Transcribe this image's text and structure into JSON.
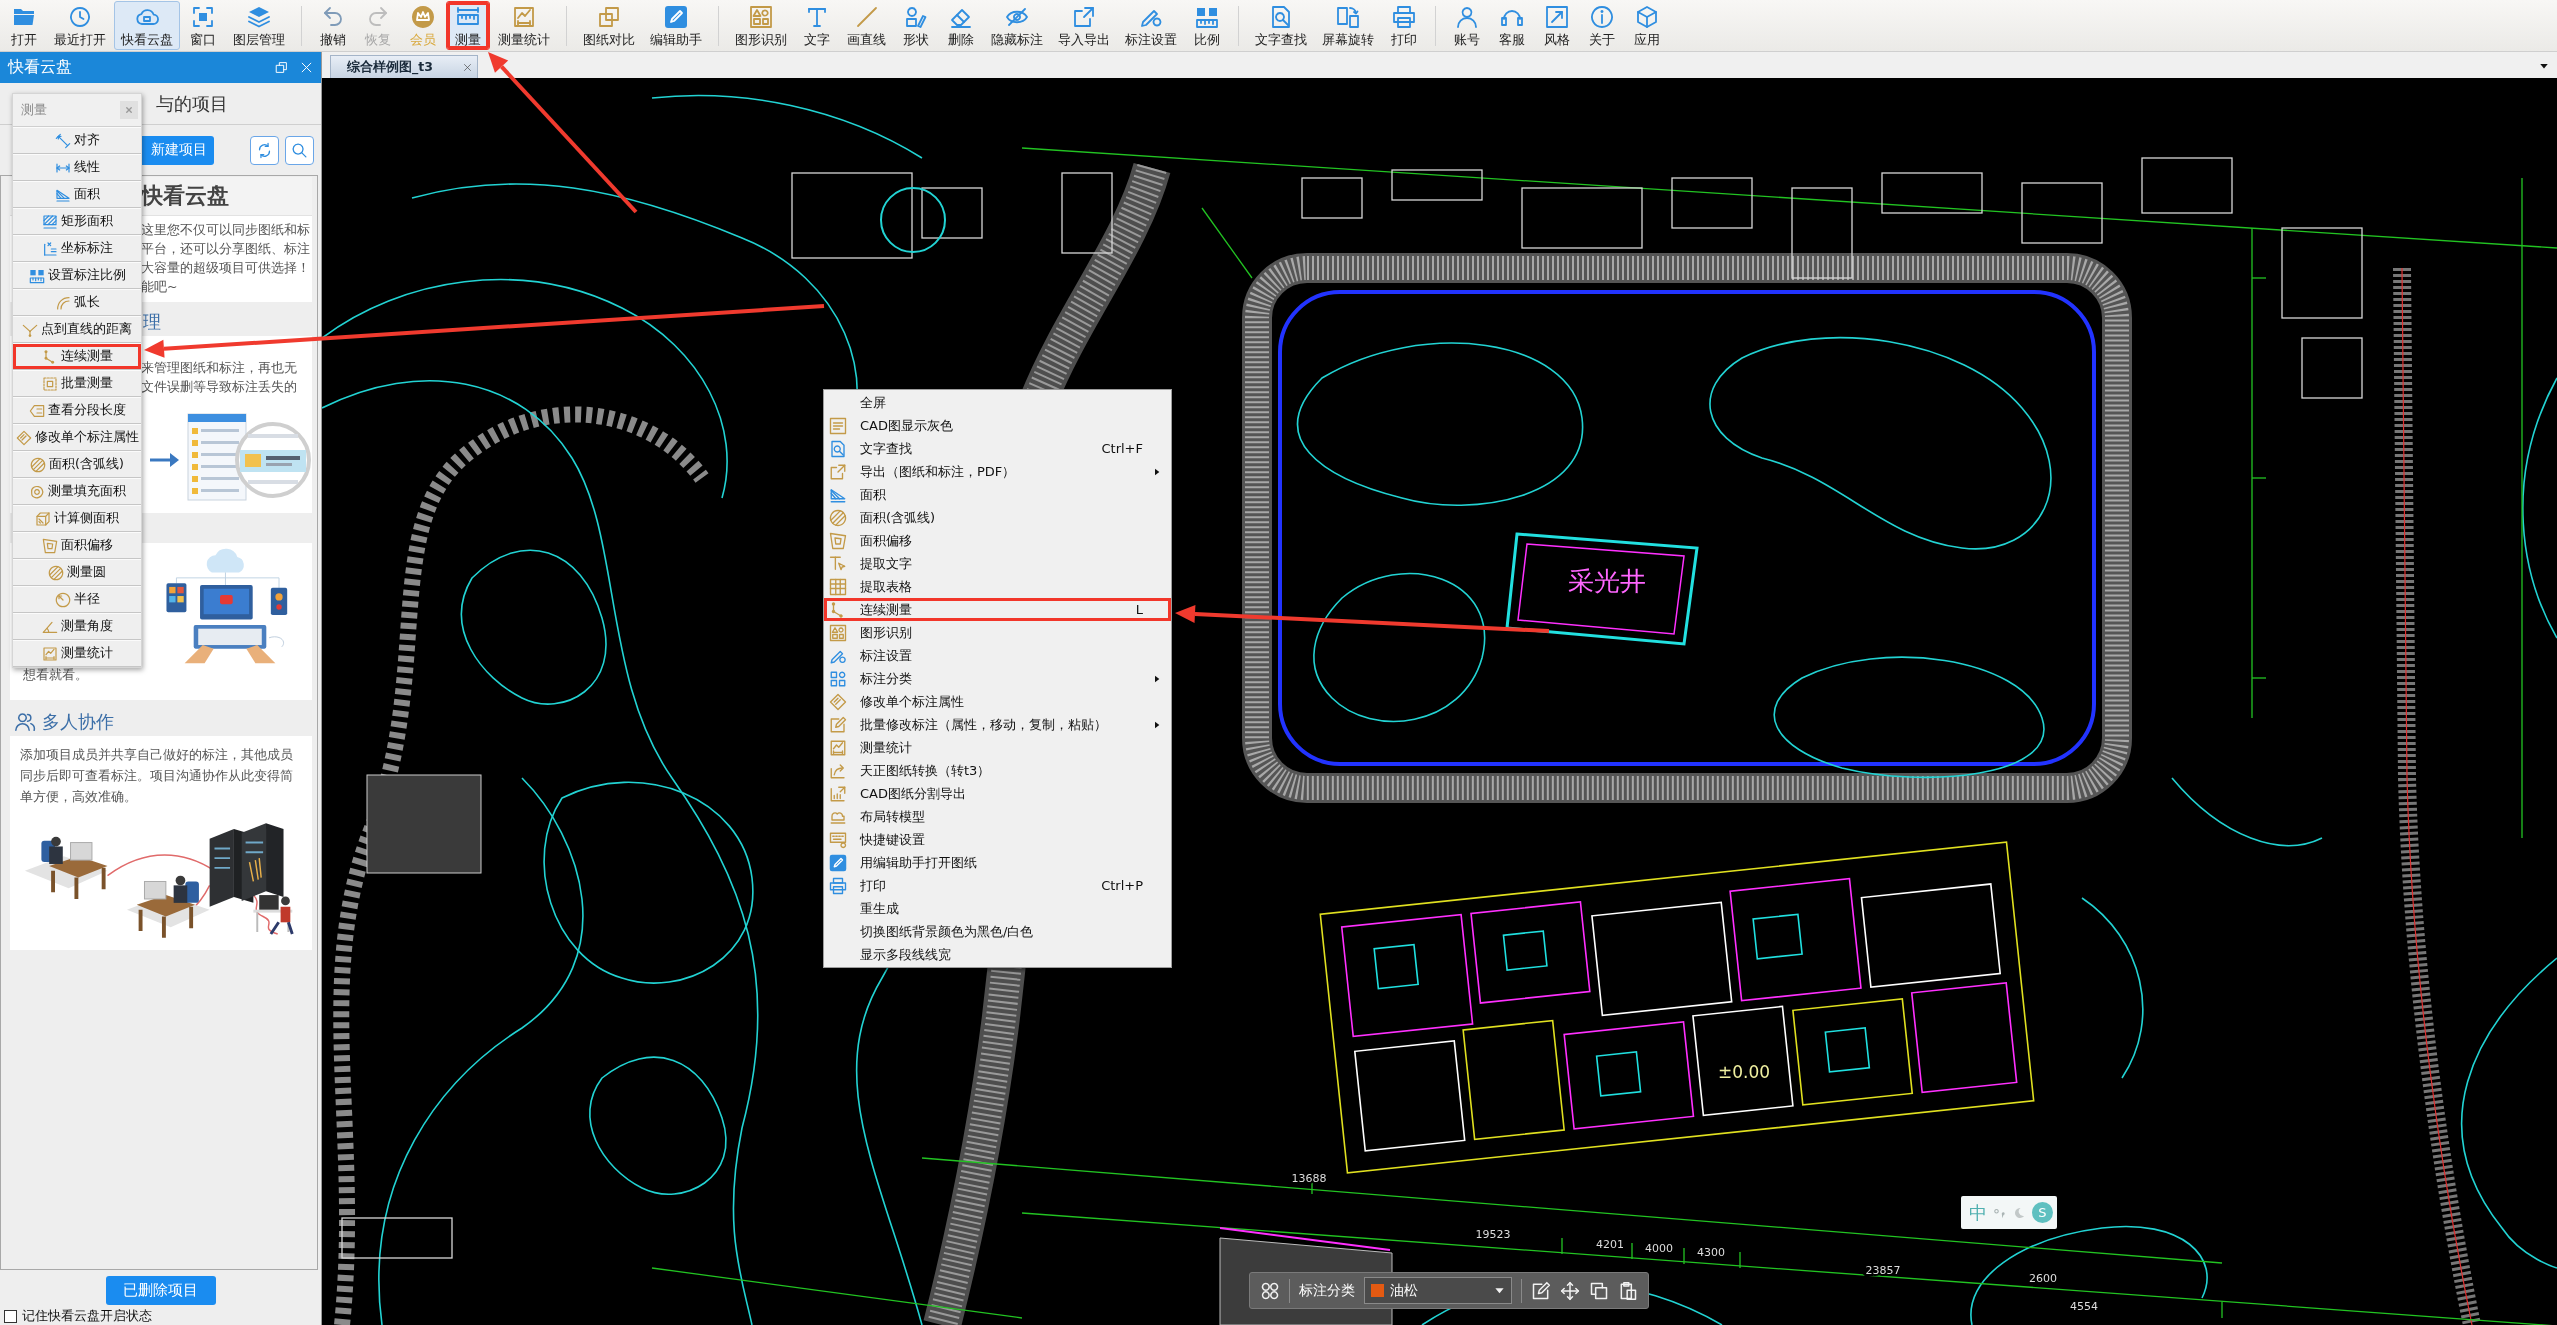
{
  "toolbar": {
    "groups": [
      [
        {
          "label": "打开",
          "kind": "tool",
          "active": false,
          "disabled": false,
          "callout": false
        },
        {
          "label": "最近打开",
          "kind": "tool",
          "active": false,
          "disabled": false,
          "callout": false
        },
        {
          "label": "快看云盘",
          "kind": "tool",
          "active": true,
          "disabled": false,
          "callout": false
        },
        {
          "label": "窗口",
          "kind": "tool",
          "active": false,
          "disabled": false,
          "callout": false
        },
        {
          "label": "图层管理",
          "kind": "tool",
          "active": false,
          "disabled": false,
          "callout": false
        }
      ],
      [
        {
          "label": "撤销",
          "kind": "tool",
          "active": false,
          "disabled": false,
          "callout": false
        },
        {
          "label": "恢复",
          "kind": "tool",
          "active": false,
          "disabled": true,
          "callout": false
        },
        {
          "label": "会员",
          "kind": "vip",
          "active": false,
          "disabled": false,
          "callout": false
        },
        {
          "label": "测量",
          "kind": "tool",
          "active": true,
          "disabled": false,
          "callout": true
        },
        {
          "label": "测量统计",
          "kind": "tool",
          "active": false,
          "disabled": false,
          "callout": false
        }
      ],
      [
        {
          "label": "图纸对比",
          "kind": "tool",
          "active": false,
          "disabled": false,
          "callout": false
        },
        {
          "label": "编辑助手",
          "kind": "tool",
          "active": false,
          "disabled": false,
          "callout": false
        }
      ],
      [
        {
          "label": "图形识别",
          "kind": "tool",
          "active": false,
          "disabled": false,
          "callout": false
        },
        {
          "label": "文字",
          "kind": "tool",
          "active": false,
          "disabled": false,
          "callout": false
        },
        {
          "label": "画直线",
          "kind": "tool",
          "active": false,
          "disabled": false,
          "callout": false
        },
        {
          "label": "形状",
          "kind": "tool",
          "active": false,
          "disabled": false,
          "callout": false
        },
        {
          "label": "删除",
          "kind": "tool",
          "active": false,
          "disabled": false,
          "callout": false
        },
        {
          "label": "隐藏标注",
          "kind": "tool",
          "active": false,
          "disabled": false,
          "callout": false
        },
        {
          "label": "导入导出",
          "kind": "tool",
          "active": false,
          "disabled": false,
          "callout": false
        },
        {
          "label": "标注设置",
          "kind": "tool",
          "active": false,
          "disabled": false,
          "callout": false
        },
        {
          "label": "比例",
          "kind": "tool",
          "active": false,
          "disabled": false,
          "callout": false
        }
      ],
      [
        {
          "label": "文字查找",
          "kind": "tool",
          "active": false,
          "disabled": false,
          "callout": false
        },
        {
          "label": "屏幕旋转",
          "kind": "tool",
          "active": false,
          "disabled": false,
          "callout": false
        },
        {
          "label": "打印",
          "kind": "tool",
          "active": false,
          "disabled": false,
          "callout": false
        }
      ],
      [
        {
          "label": "账号",
          "kind": "tool",
          "active": false,
          "disabled": false,
          "callout": false
        },
        {
          "label": "客服",
          "kind": "tool",
          "active": false,
          "disabled": false,
          "callout": false
        },
        {
          "label": "风格",
          "kind": "tool",
          "active": false,
          "disabled": false,
          "callout": false
        },
        {
          "label": "关于",
          "kind": "tool",
          "active": false,
          "disabled": false,
          "callout": false
        },
        {
          "label": "应用",
          "kind": "tool",
          "active": false,
          "disabled": false,
          "callout": false
        }
      ]
    ]
  },
  "tabs": [
    {
      "label": "综合样例图_t3",
      "selected": true
    }
  ],
  "cloud_panel": {
    "title": "快看云盘",
    "projects_heading": "与的项目",
    "new_project_button": "新建项目",
    "cards": [
      {
        "heading": "快看云盘",
        "lines": [
          "这里您不仅可以同步图纸和标",
          "平台，还可以分享图纸、标注",
          "大容量的超级项目可供选择！",
          "能吧~"
        ]
      },
      {
        "heading": "理",
        "lines": [
          "来管理图纸和标注，再也无",
          "文件误删等导致标注丢失的"
        ]
      },
      {
        "lines": [
          "想看就看。"
        ]
      },
      {
        "heading": "多人协作",
        "lines": [
          "添加项目成员并共享自己做好的标注，其他成员同步后即可查看标注。项目沟通协作从此变得简单方便，高效准确。"
        ]
      }
    ],
    "deleted_button": "已删除项目",
    "remember_checkbox": {
      "label": "记住快看云盘开启状态",
      "checked": false
    }
  },
  "measure_popup": {
    "title": "测量",
    "items": [
      {
        "label": "对齐",
        "callout": false
      },
      {
        "label": "线性",
        "callout": false
      },
      {
        "label": "面积",
        "callout": false
      },
      {
        "label": "矩形面积",
        "callout": false
      },
      {
        "label": "坐标标注",
        "callout": false
      },
      {
        "label": "设置标注比例",
        "callout": false
      },
      {
        "label": "弧长",
        "callout": false
      },
      {
        "label": "点到直线的距离",
        "callout": false
      },
      {
        "label": "连续测量",
        "callout": true
      },
      {
        "label": "批量测量",
        "callout": false
      },
      {
        "label": "查看分段长度",
        "callout": false
      },
      {
        "label": "修改单个标注属性",
        "callout": false
      },
      {
        "label": "面积(含弧线)",
        "callout": false
      },
      {
        "label": "测量填充面积",
        "callout": false
      },
      {
        "label": "计算侧面积",
        "callout": false
      },
      {
        "label": "面积偏移",
        "callout": false
      },
      {
        "label": "测量圆",
        "callout": false
      },
      {
        "label": "半径",
        "callout": false
      },
      {
        "label": "测量角度",
        "callout": false
      },
      {
        "label": "测量统计",
        "callout": false
      }
    ]
  },
  "context_menu": {
    "items": [
      {
        "label": "全屏",
        "submenu": false,
        "callout": false
      },
      {
        "label": "CAD图显示灰色",
        "submenu": false,
        "callout": false
      },
      {
        "label": "文字查找",
        "shortcut": "Ctrl+F",
        "submenu": false,
        "callout": false
      },
      {
        "label": "导出（图纸和标注，PDF）",
        "submenu": true,
        "callout": false
      },
      {
        "label": "面积",
        "submenu": false,
        "callout": false
      },
      {
        "label": "面积(含弧线)",
        "submenu": false,
        "callout": false
      },
      {
        "label": "面积偏移",
        "submenu": false,
        "callout": false
      },
      {
        "label": "提取文字",
        "submenu": false,
        "callout": false
      },
      {
        "label": "提取表格",
        "submenu": false,
        "callout": false
      },
      {
        "label": "连续测量",
        "shortcut": "L",
        "submenu": false,
        "callout": true
      },
      {
        "label": "图形识别",
        "submenu": false,
        "callout": false
      },
      {
        "label": "标注设置",
        "submenu": false,
        "callout": false
      },
      {
        "label": "标注分类",
        "submenu": true,
        "callout": false
      },
      {
        "label": "修改单个标注属性",
        "submenu": false,
        "callout": false
      },
      {
        "label": "批量修改标注（属性，移动，复制，粘贴）",
        "submenu": true,
        "callout": false
      },
      {
        "label": "测量统计",
        "submenu": false,
        "callout": false
      },
      {
        "label": "天正图纸转换（转t3）",
        "submenu": false,
        "callout": false
      },
      {
        "label": "CAD图纸分割导出",
        "submenu": false,
        "callout": false
      },
      {
        "label": "布局转模型",
        "submenu": false,
        "callout": false
      },
      {
        "label": "快捷键设置",
        "submenu": false,
        "callout": false
      },
      {
        "label": "用编辑助手打开图纸",
        "submenu": false,
        "callout": false
      },
      {
        "label": "打印",
        "shortcut": "Ctrl+P",
        "submenu": false,
        "callout": false
      },
      {
        "label": "重生成",
        "submenu": false,
        "callout": false
      },
      {
        "label": "切换图纸背景颜色为黑色/白色",
        "submenu": false,
        "callout": false
      },
      {
        "label": "显示多段线线宽",
        "submenu": false,
        "callout": false
      }
    ]
  },
  "annotation_bar": {
    "label": "标注分类",
    "category": {
      "name": "油松",
      "color": "#e45a12"
    }
  },
  "ime": {
    "mode": "中",
    "logo": "S"
  },
  "cad_labels": [
    "采光井",
    "±0.00",
    "13688",
    "19523",
    "4201",
    "4000",
    "4300",
    "23857",
    "2600",
    "4554"
  ]
}
